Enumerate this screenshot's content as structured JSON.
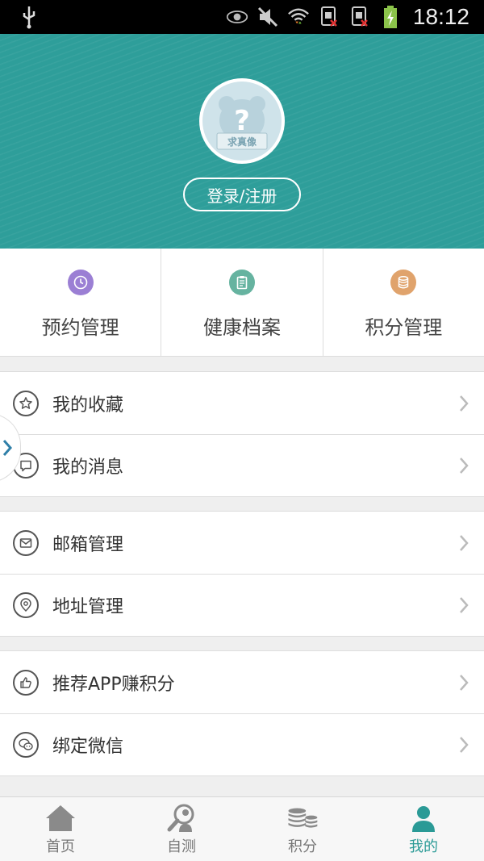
{
  "status_bar": {
    "time": "18:12",
    "icons": [
      "usb-icon",
      "eye-icon",
      "muted-icon",
      "wifi-icon",
      "sim1-no-signal-icon",
      "sim2-no-signal-icon",
      "battery-charging-icon"
    ]
  },
  "header": {
    "avatar_caption": "求真像",
    "login_label": "登录/注册",
    "bg_color": "#2e9e9a"
  },
  "quick_actions": [
    {
      "label": "预约管理",
      "icon": "clock-icon",
      "color": "#9b7fd4"
    },
    {
      "label": "健康档案",
      "icon": "clipboard-icon",
      "color": "#66b3a0"
    },
    {
      "label": "积分管理",
      "icon": "database-icon",
      "color": "#e0a36c"
    }
  ],
  "groups": [
    {
      "items": [
        {
          "label": "我的收藏",
          "icon": "star-icon"
        },
        {
          "label": "我的消息",
          "icon": "message-icon"
        }
      ]
    },
    {
      "items": [
        {
          "label": "邮箱管理",
          "icon": "mail-icon"
        },
        {
          "label": "地址管理",
          "icon": "location-icon"
        }
      ]
    },
    {
      "items": [
        {
          "label": "推荐APP赚积分",
          "icon": "thumbs-up-icon"
        },
        {
          "label": "绑定微信",
          "icon": "wechat-icon"
        }
      ]
    }
  ],
  "bottom_nav": [
    {
      "label": "首页",
      "icon": "home-icon",
      "active": false
    },
    {
      "label": "自测",
      "icon": "self-test-icon",
      "active": false
    },
    {
      "label": "积分",
      "icon": "coins-icon",
      "active": false
    },
    {
      "label": "我的",
      "icon": "user-icon",
      "active": true
    }
  ],
  "accent_color": "#2a9a96"
}
